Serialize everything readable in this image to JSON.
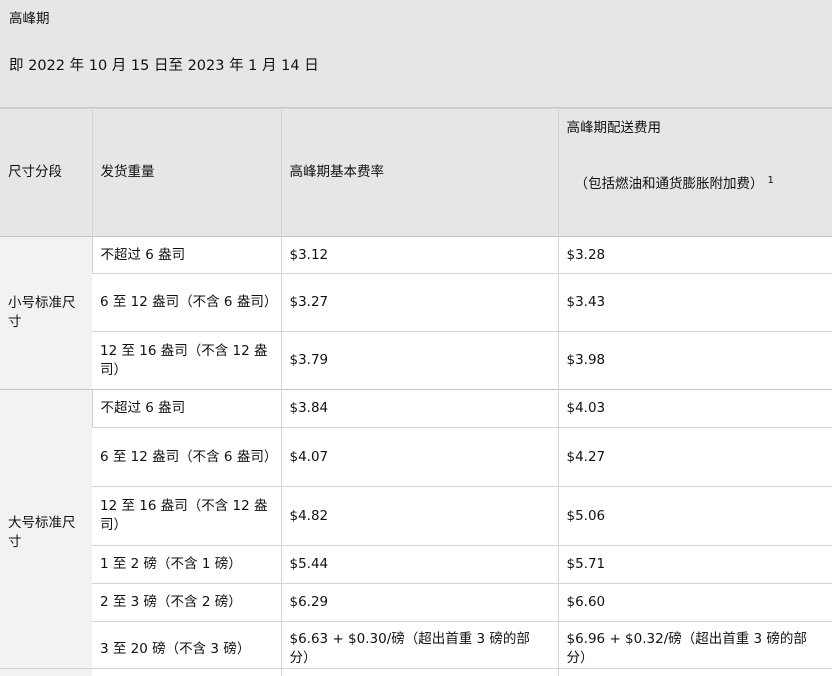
{
  "header": {
    "title": "高峰期",
    "dates": "即 2022 年 10 月 15 日至 2023 年 1 月 14 日"
  },
  "table": {
    "columns": {
      "size_tier": "尺寸分段",
      "weight": "发货重量",
      "base_rate": "高峰期基本费率",
      "surcharge_title": "高峰期配送费用",
      "surcharge_sub": "（包括燃油和通货膨胀附加费）",
      "surcharge_footnote": "1"
    },
    "small": {
      "tier": "小号标准尺寸",
      "rows": [
        {
          "weight": "不超过 6 盎司",
          "base": "$3.12",
          "peak": "$3.28"
        },
        {
          "weight": "6 至 12 盎司（不含 6 盎司）",
          "base": "$3.27",
          "peak": "$3.43"
        },
        {
          "weight": "12 至 16 盎司（不含 12 盎司）",
          "base": "$3.79",
          "peak": "$3.98"
        }
      ]
    },
    "large": {
      "tier": "大号标准尺寸",
      "rows": [
        {
          "weight": "不超过 6 盎司",
          "base": "$3.84",
          "peak": "$4.03"
        },
        {
          "weight": "6 至 12 盎司（不含 6 盎司）",
          "base": "$4.07",
          "peak": "$4.27"
        },
        {
          "weight": "12 至 16 盎司（不含 12 盎司）",
          "base": "$4.82",
          "peak": "$5.06"
        },
        {
          "weight": "1 至 2 磅（不含 1 磅）",
          "base": "$5.44",
          "peak": "$5.71"
        },
        {
          "weight": "2 至 3 磅（不含 2 磅）",
          "base": "$6.29",
          "peak": "$6.60"
        },
        {
          "weight": "3 至 20 磅（不含 3 磅）",
          "base": "$6.63 + $0.30/磅（超出首重 3 磅的部分）",
          "peak": "$6.96 + $0.32/磅（超出首重 3 磅的部分）"
        }
      ]
    }
  }
}
